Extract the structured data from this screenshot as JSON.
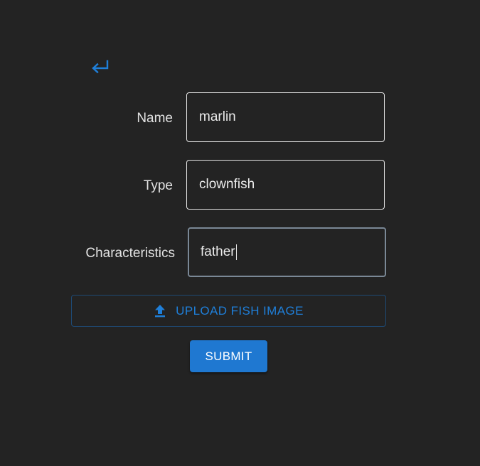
{
  "colors": {
    "background": "#232323",
    "accent": "#1f78d1",
    "accent_text": "#1f7fd9",
    "field_border": "#e6e6e6",
    "label_text": "#e2e2e2"
  },
  "back": {
    "icon": "return-arrow-icon"
  },
  "form": {
    "name": {
      "label": "Name",
      "value": "marlin"
    },
    "type": {
      "label": "Type",
      "value": "clownfish"
    },
    "characteristics": {
      "label": "Characteristics",
      "value": "father"
    }
  },
  "upload": {
    "icon": "upload-icon",
    "label": "UPLOAD FISH IMAGE"
  },
  "submit": {
    "label": "SUBMIT"
  }
}
